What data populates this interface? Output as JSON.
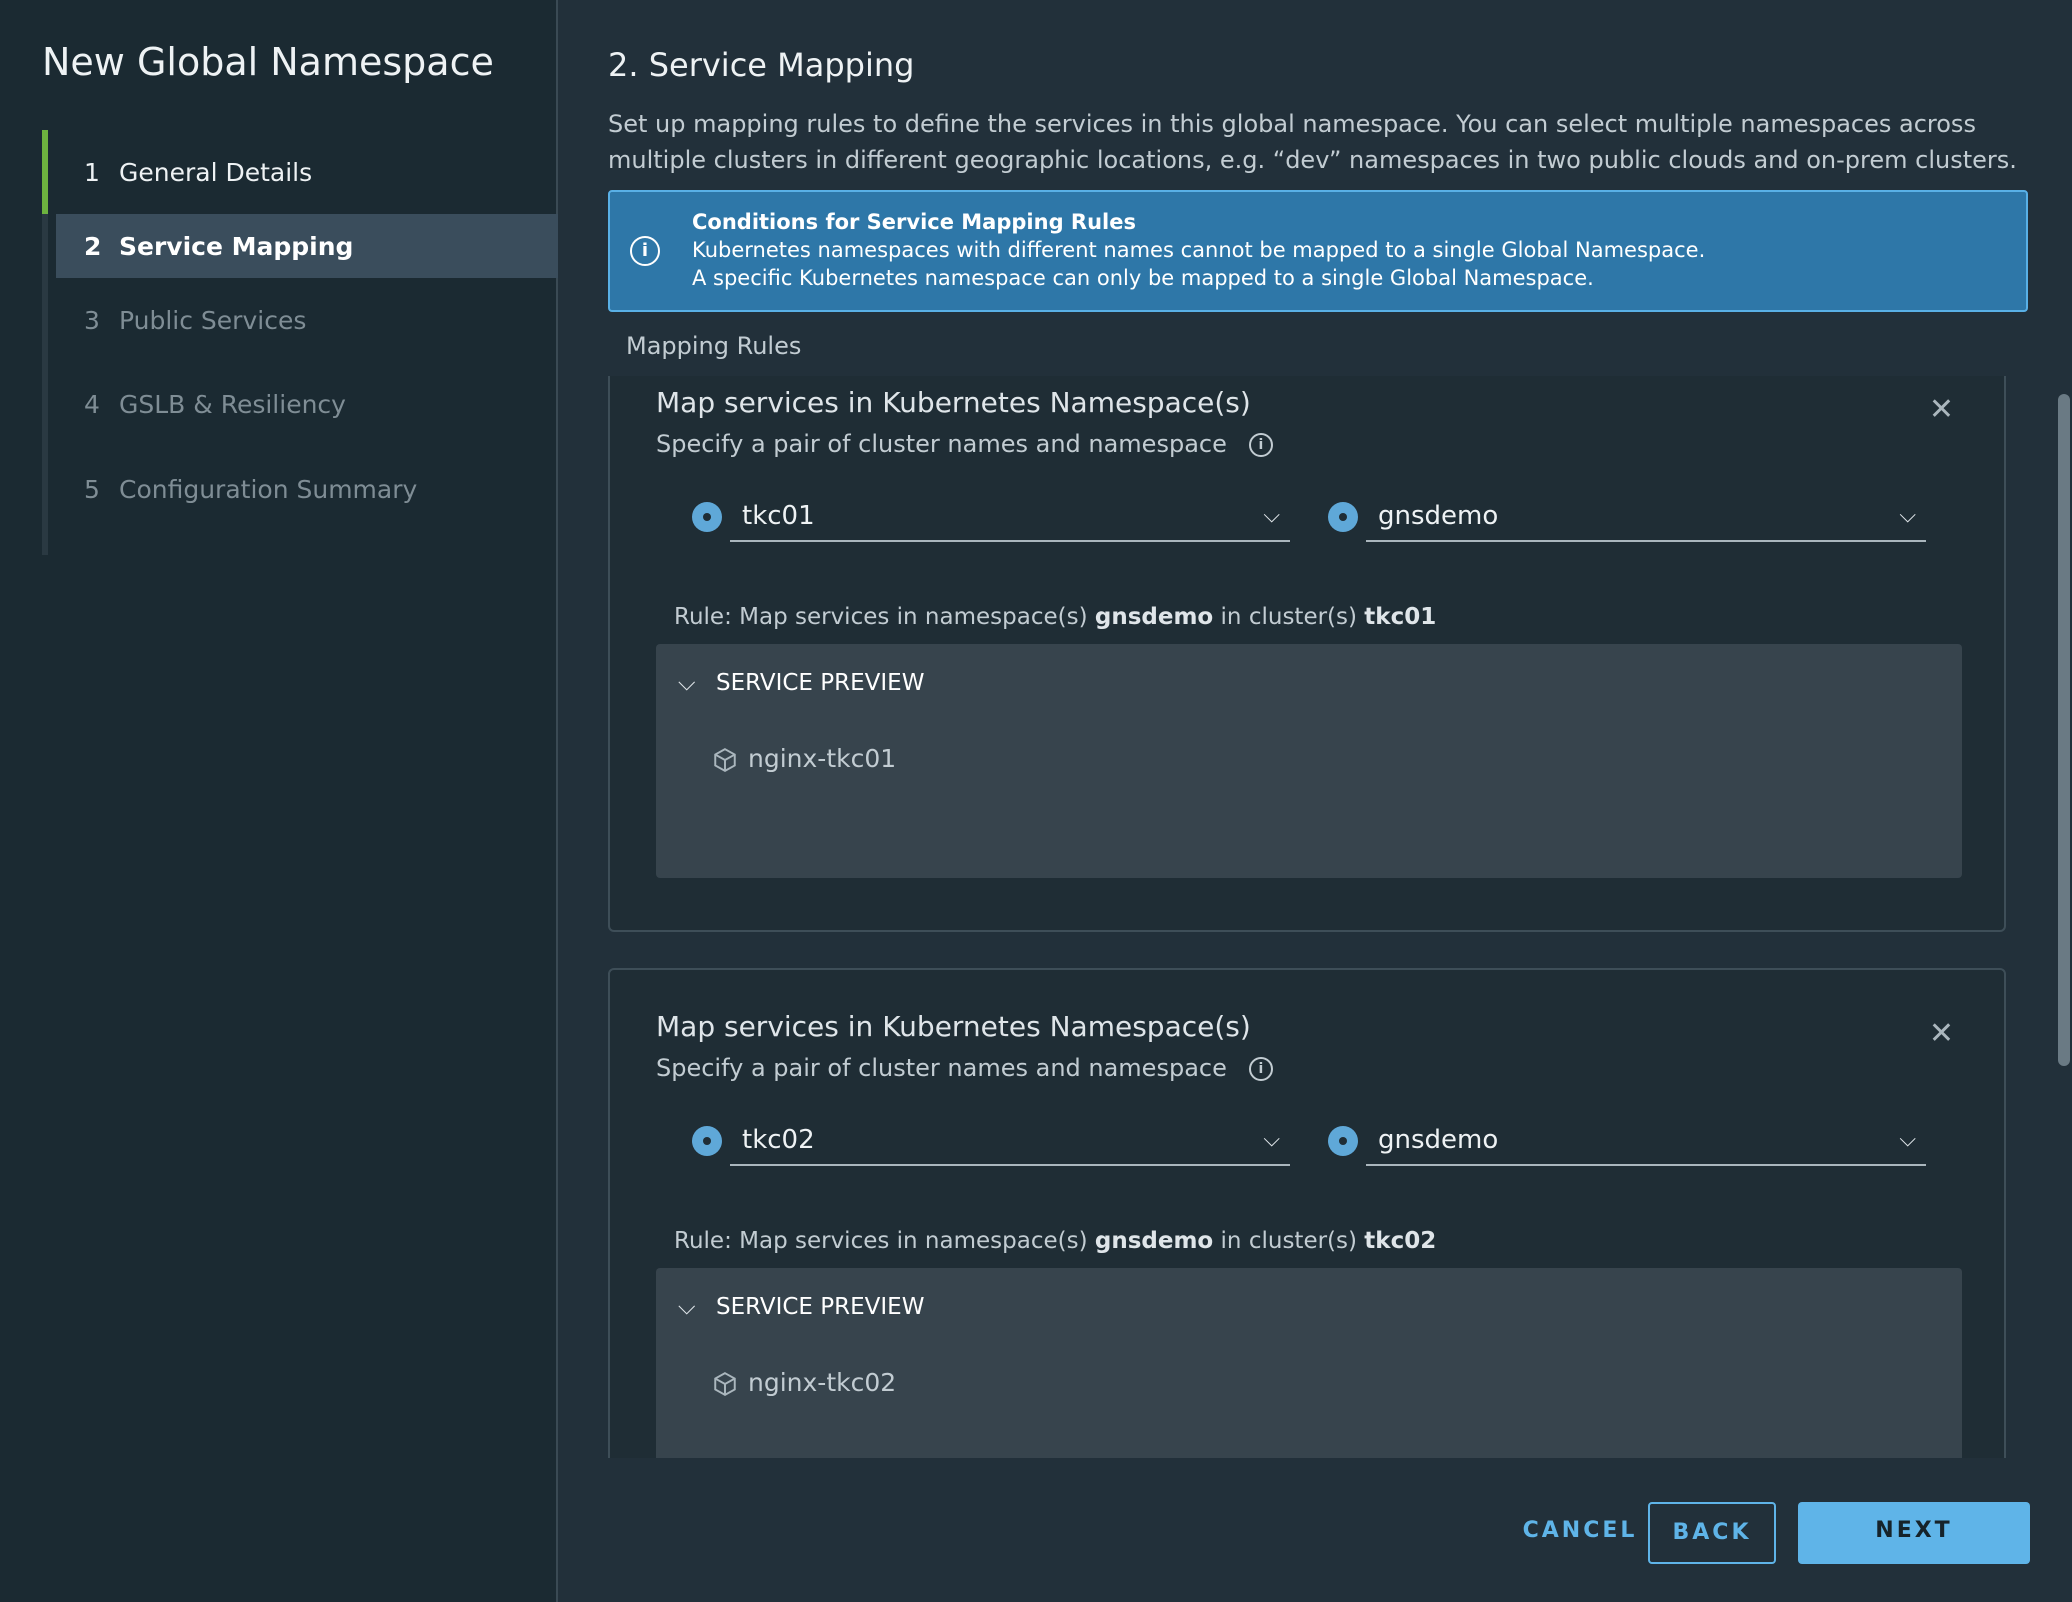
{
  "wizard": {
    "title": "New Global Namespace",
    "steps": [
      {
        "num": "1",
        "label": "General Details"
      },
      {
        "num": "2",
        "label": "Service Mapping"
      },
      {
        "num": "3",
        "label": "Public Services"
      },
      {
        "num": "4",
        "label": "GSLB & Resiliency"
      },
      {
        "num": "5",
        "label": "Configuration Summary"
      }
    ]
  },
  "page": {
    "title": "2. Service Mapping",
    "description": "Set up mapping rules to define the services in this global namespace. You can select multiple namespaces across multiple clusters in different geographic locations, e.g. “dev” namespaces in two public clouds and on-prem clusters."
  },
  "alert": {
    "title": "Conditions for Service Mapping Rules",
    "line1": "Kubernetes namespaces with different names cannot be mapped to a single Global Namespace.",
    "line2": "A specific Kubernetes namespace can only be mapped to a single Global Namespace."
  },
  "mapping_label": "Mapping Rules",
  "rules": [
    {
      "title": "Map services in Kubernetes Namespace(s)",
      "subtitle": "Specify a pair of cluster names and namespace",
      "cluster": "tkc01",
      "namespace": "gnsdemo",
      "rule_prefix": "Rule: Map services in namespace(s)",
      "rule_mid": "in cluster(s)",
      "preview_label": "SERVICE PREVIEW",
      "service": "nginx-tkc01"
    },
    {
      "title": "Map services in Kubernetes Namespace(s)",
      "subtitle": "Specify a pair of cluster names and namespace",
      "cluster": "tkc02",
      "namespace": "gnsdemo",
      "rule_prefix": "Rule: Map services in namespace(s)",
      "rule_mid": "in cluster(s)",
      "preview_label": "SERVICE PREVIEW",
      "service": "nginx-tkc02"
    }
  ],
  "buttons": {
    "cancel": "CANCEL",
    "back": "BACK",
    "next": "NEXT"
  },
  "icons": {
    "info": "info-circle-icon",
    "close": "close-icon",
    "chevron": "chevron-down-icon",
    "cube": "cube-icon"
  },
  "colors": {
    "accent": "#5fb4e8",
    "alert_bg": "#2e77a8",
    "step_done": "#6db33f"
  }
}
